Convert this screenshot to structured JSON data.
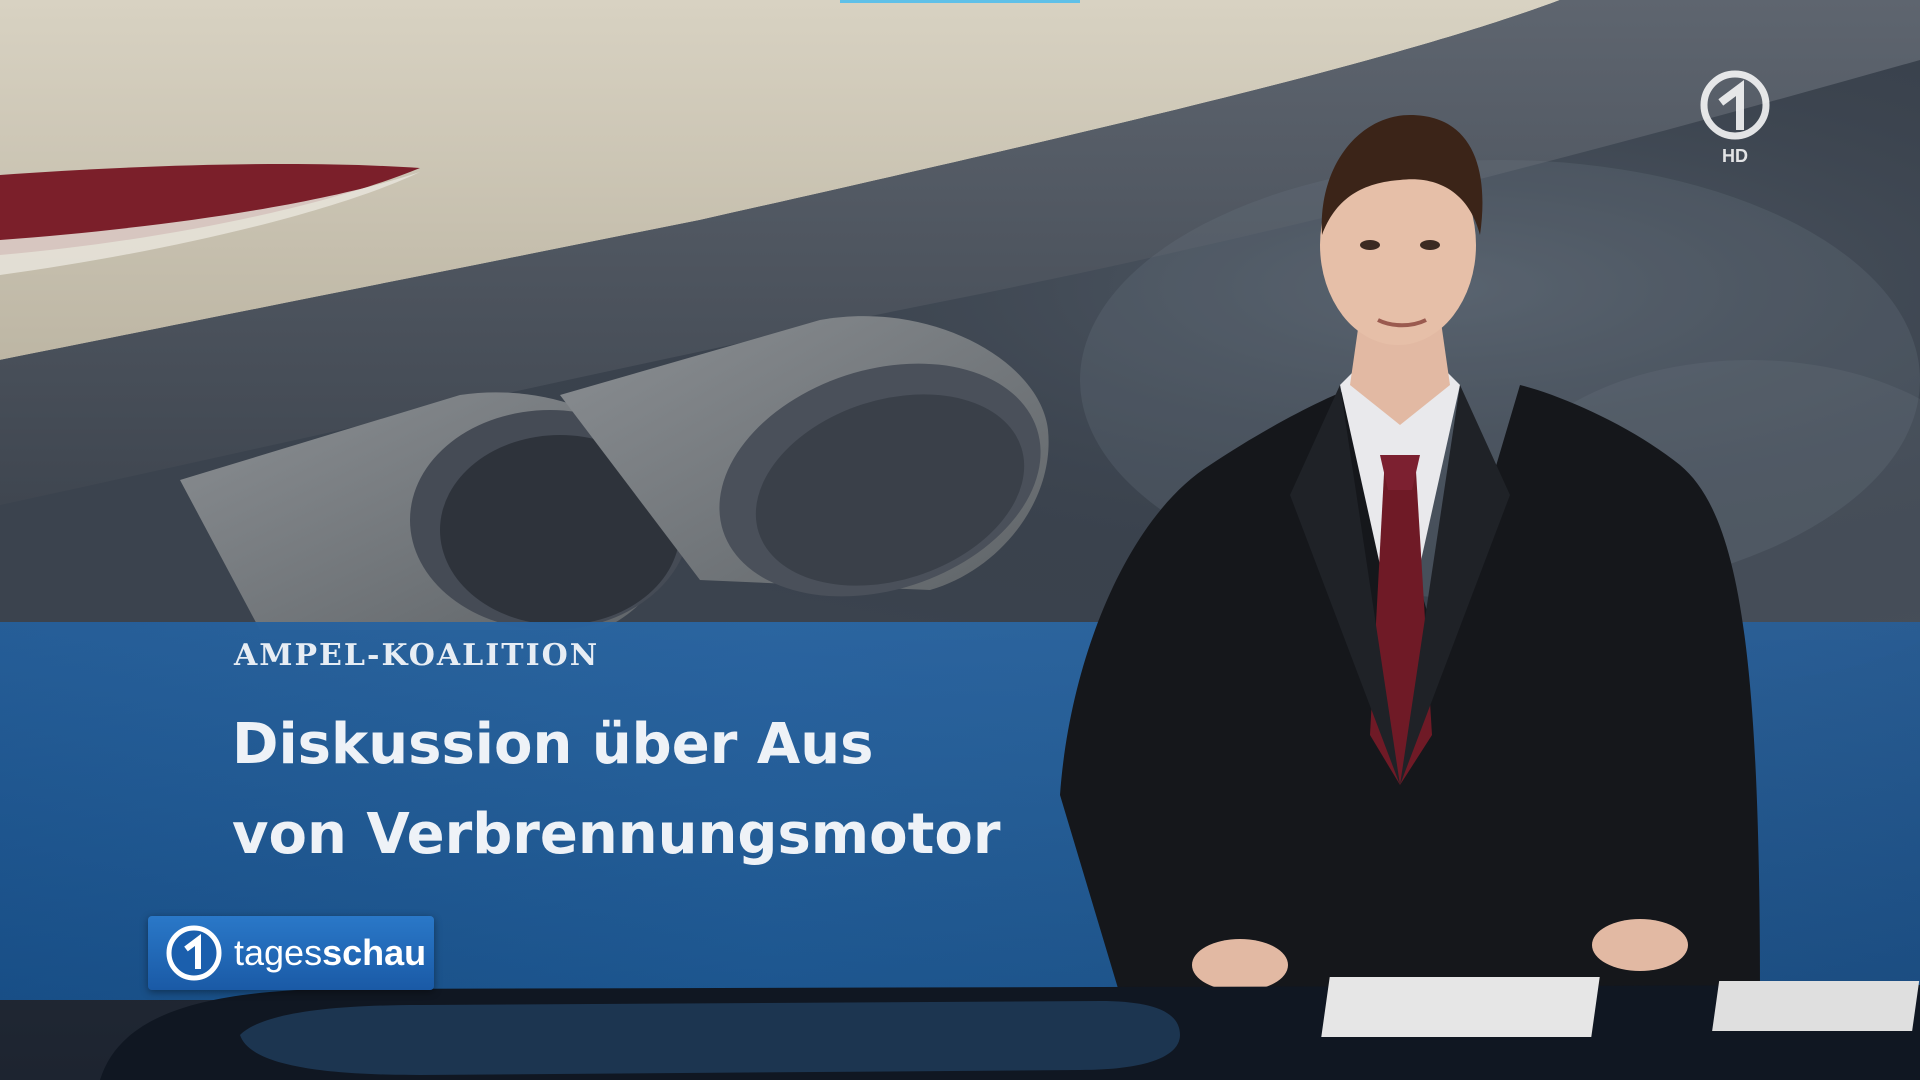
{
  "broadcast": {
    "kicker": "AMPEL-KOALITION",
    "headline_line1": "Diskussion über Aus",
    "headline_line2": "von Verbrennungsmotor"
  },
  "brand": {
    "name_light": "tages",
    "name_bold": "schau",
    "logo_icon": "das-erste-logo-icon"
  },
  "channel": {
    "logo_icon": "das-erste-1-logo-icon",
    "quality": "HD"
  },
  "colors": {
    "band_blue": "#1f5f9f",
    "badge_blue": "#1a5aa6",
    "accent_cyan": "#5fc0e8",
    "tie_red": "#6f1a26"
  }
}
